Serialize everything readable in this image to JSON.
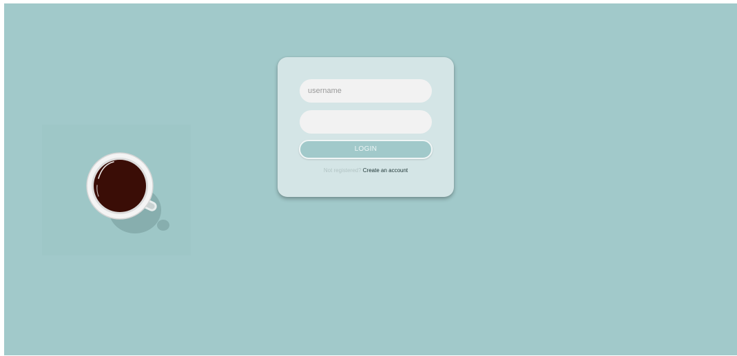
{
  "login_form": {
    "username_placeholder": "username",
    "password_placeholder": "",
    "login_label": "LOGIN",
    "not_registered_text": "Not registered?",
    "create_account_label": "Create an account"
  },
  "colors": {
    "background": "#a1c9ca",
    "card": "#d4e5e6",
    "field": "#f2f2f2",
    "coffee": "#3a0d06"
  },
  "decoration": {
    "icon": "coffee-cup-icon"
  }
}
